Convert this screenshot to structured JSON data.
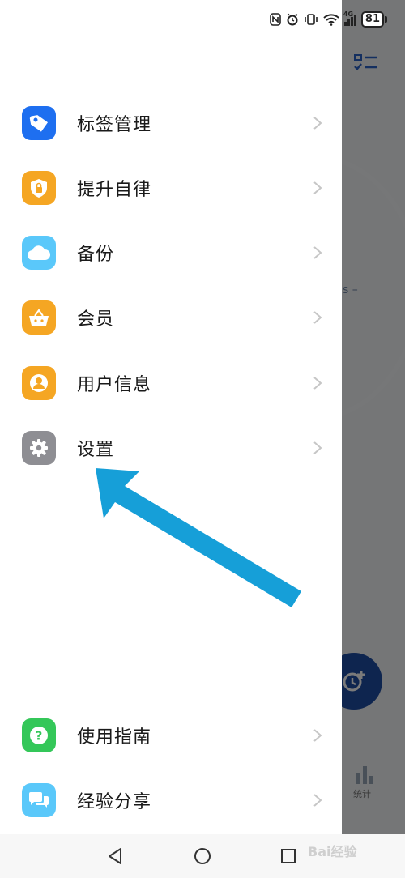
{
  "status_bar": {
    "icons": [
      "nfc-icon",
      "alarm-icon",
      "vibrate-icon",
      "wifi-icon",
      "signal-4g-icon"
    ],
    "network_label": "4G",
    "battery_level": "81"
  },
  "drawer": {
    "items": [
      {
        "label": "标签管理",
        "icon": "tag-icon",
        "color": "#1E6FF0"
      },
      {
        "label": "提升自律",
        "icon": "lock-shield-icon",
        "color": "#F5A623"
      },
      {
        "label": "备份",
        "icon": "cloud-icon",
        "color": "#5AC8FA"
      },
      {
        "label": "会员",
        "icon": "basket-icon",
        "color": "#F5A623"
      },
      {
        "label": "用户信息",
        "icon": "user-icon",
        "color": "#F5A623"
      },
      {
        "label": "设置",
        "icon": "gear-icon",
        "color": "#8E8E93"
      },
      {
        "label": "使用指南",
        "icon": "question-icon",
        "color": "#34C759"
      },
      {
        "label": "经验分享",
        "icon": "chat-bubbles-icon",
        "color": "#5AC8FA"
      }
    ]
  },
  "background_app": {
    "dash_text": "s –",
    "stat_label": "统计"
  },
  "nav_bar": {
    "buttons": [
      "back-icon",
      "home-icon",
      "recents-icon"
    ]
  },
  "annotation": {
    "arrow_color": "#169FD8"
  },
  "watermark": "Bai经验"
}
